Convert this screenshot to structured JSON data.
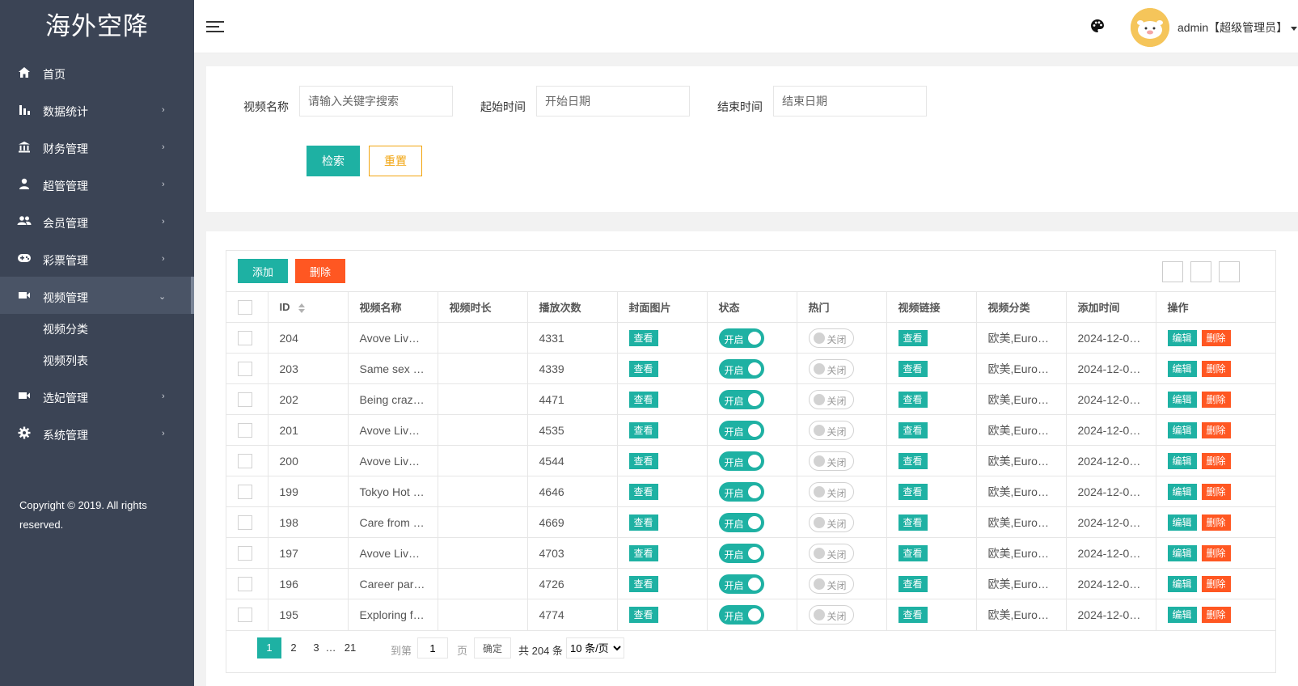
{
  "brand": "海外空降",
  "sidebar": {
    "items": [
      {
        "label": "首页",
        "icon": "home-icon"
      },
      {
        "label": "数据统计",
        "icon": "bar-chart-icon"
      },
      {
        "label": "财务管理",
        "icon": "bank-icon"
      },
      {
        "label": "超管管理",
        "icon": "user-icon"
      },
      {
        "label": "会员管理",
        "icon": "users-icon"
      },
      {
        "label": "彩票管理",
        "icon": "gamepad-icon"
      },
      {
        "label": "视频管理",
        "icon": "video-icon"
      },
      {
        "label": "选妃管理",
        "icon": "video-icon"
      },
      {
        "label": "系统管理",
        "icon": "gear-icon"
      }
    ],
    "submenu": [
      "视频分类",
      "视频列表"
    ],
    "copyright_line1": "Copyright © 2019. All rights",
    "copyright_line2": "reserved."
  },
  "header": {
    "user": "admin【超级管理员】"
  },
  "search": {
    "name_label": "视频名称",
    "name_placeholder": "请输入关键字搜索",
    "start_label": "起始时间",
    "start_placeholder": "开始日期",
    "end_label": "结束时间",
    "end_placeholder": "结束日期",
    "search_btn": "检索",
    "reset_btn": "重置"
  },
  "toolbar": {
    "add": "添加",
    "delete": "删除"
  },
  "table": {
    "columns": [
      "ID",
      "视频名称",
      "视频时长",
      "播放次数",
      "封面图片",
      "状态",
      "热门",
      "视频链接",
      "视频分类",
      "添加时间",
      "操作"
    ],
    "view_label": "查看",
    "on_label": "开启",
    "off_label": "关闭",
    "edit_label": "编辑",
    "del_label": "删除",
    "rows": [
      {
        "id": "204",
        "name": "Avove Live…",
        "duration": "",
        "plays": "4331",
        "category": "欧美,Euro…",
        "added": "2024-12-0…"
      },
      {
        "id": "203",
        "name": "Same sex …",
        "duration": "",
        "plays": "4339",
        "category": "欧美,Euro…",
        "added": "2024-12-0…"
      },
      {
        "id": "202",
        "name": "Being craz…",
        "duration": "",
        "plays": "4471",
        "category": "欧美,Euro…",
        "added": "2024-12-0…"
      },
      {
        "id": "201",
        "name": "Avove Live…",
        "duration": "",
        "plays": "4535",
        "category": "欧美,Euro…",
        "added": "2024-12-0…"
      },
      {
        "id": "200",
        "name": "Avove Live…",
        "duration": "",
        "plays": "4544",
        "category": "欧美,Euro…",
        "added": "2024-12-0…"
      },
      {
        "id": "199",
        "name": "Tokyo Hot …",
        "duration": "",
        "plays": "4646",
        "category": "欧美,Euro…",
        "added": "2024-12-0…"
      },
      {
        "id": "198",
        "name": "Care from …",
        "duration": "",
        "plays": "4669",
        "category": "欧美,Euro…",
        "added": "2024-12-0…"
      },
      {
        "id": "197",
        "name": "Avove Live…",
        "duration": "",
        "plays": "4703",
        "category": "欧美,Euro…",
        "added": "2024-12-0…"
      },
      {
        "id": "196",
        "name": "Career par…",
        "duration": "",
        "plays": "4726",
        "category": "欧美,Euro…",
        "added": "2024-12-0…"
      },
      {
        "id": "195",
        "name": "Exploring f…",
        "duration": "",
        "plays": "4774",
        "category": "欧美,Euro…",
        "added": "2024-12-0…"
      }
    ]
  },
  "pager": {
    "pages": [
      "1",
      "2",
      "3"
    ],
    "ellipsis": "…",
    "last": "21",
    "goto_label": "到第",
    "goto_value": "1",
    "page_unit": "页",
    "ok": "确定",
    "total": "共 204 条",
    "per_page": "10 条/页"
  },
  "colors": {
    "accent": "#1eb1a3",
    "danger": "#ff5722",
    "warning": "#f2a510",
    "sidebar": "#3b4455"
  }
}
